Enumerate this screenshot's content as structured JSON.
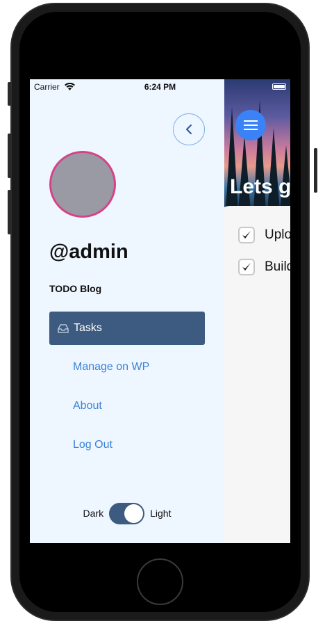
{
  "status_bar": {
    "carrier": "Carrier",
    "time": "6:24 PM"
  },
  "drawer": {
    "username": "@admin",
    "blog_name": "TODO Blog",
    "nav": [
      {
        "label": "Tasks",
        "icon": "inbox-icon",
        "active": true
      },
      {
        "label": "Manage on WP",
        "active": false
      },
      {
        "label": "About",
        "active": false
      },
      {
        "label": "Log Out",
        "active": false
      }
    ],
    "theme": {
      "dark_label": "Dark",
      "light_label": "Light",
      "selected": "Light"
    }
  },
  "main": {
    "hero_title": "Lets go",
    "tasks": [
      {
        "label": "Upload",
        "checked": true
      },
      {
        "label": "Build",
        "checked": true
      }
    ]
  },
  "colors": {
    "accent": "#3b82f6",
    "nav_active": "#3d5a80",
    "link": "#3b82d8",
    "avatar_ring": "#d6428a",
    "drawer_bg": "#eef6ff"
  }
}
